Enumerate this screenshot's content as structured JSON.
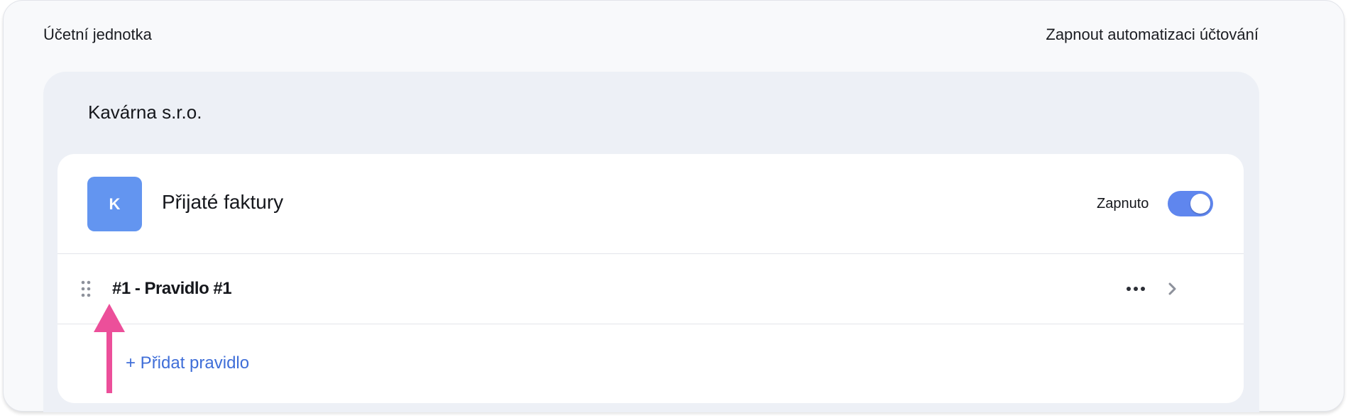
{
  "header": {
    "left_label": "Účetní jednotka",
    "right_label": "Zapnout automatizaci účtování"
  },
  "company": {
    "name": "Kavárna s.r.o."
  },
  "card": {
    "avatar_letter": "K",
    "title": "Přijaté faktury",
    "status_label": "Zapnuto",
    "toggle_on": true,
    "colors": {
      "avatar": "#6395f0",
      "toggle": "#5f86ee",
      "link": "#3f6ed8",
      "annotation_arrow": "#ec4f9a"
    }
  },
  "rules": [
    {
      "label": "#1 - Pravidlo #1"
    }
  ],
  "add_rule": {
    "label": "+ Přidat pravidlo"
  },
  "icons": {
    "drag": "drag-handle-icon",
    "more": "more-horizontal-icon",
    "chevron": "chevron-right-icon",
    "annotation": "arrow-up-icon"
  }
}
